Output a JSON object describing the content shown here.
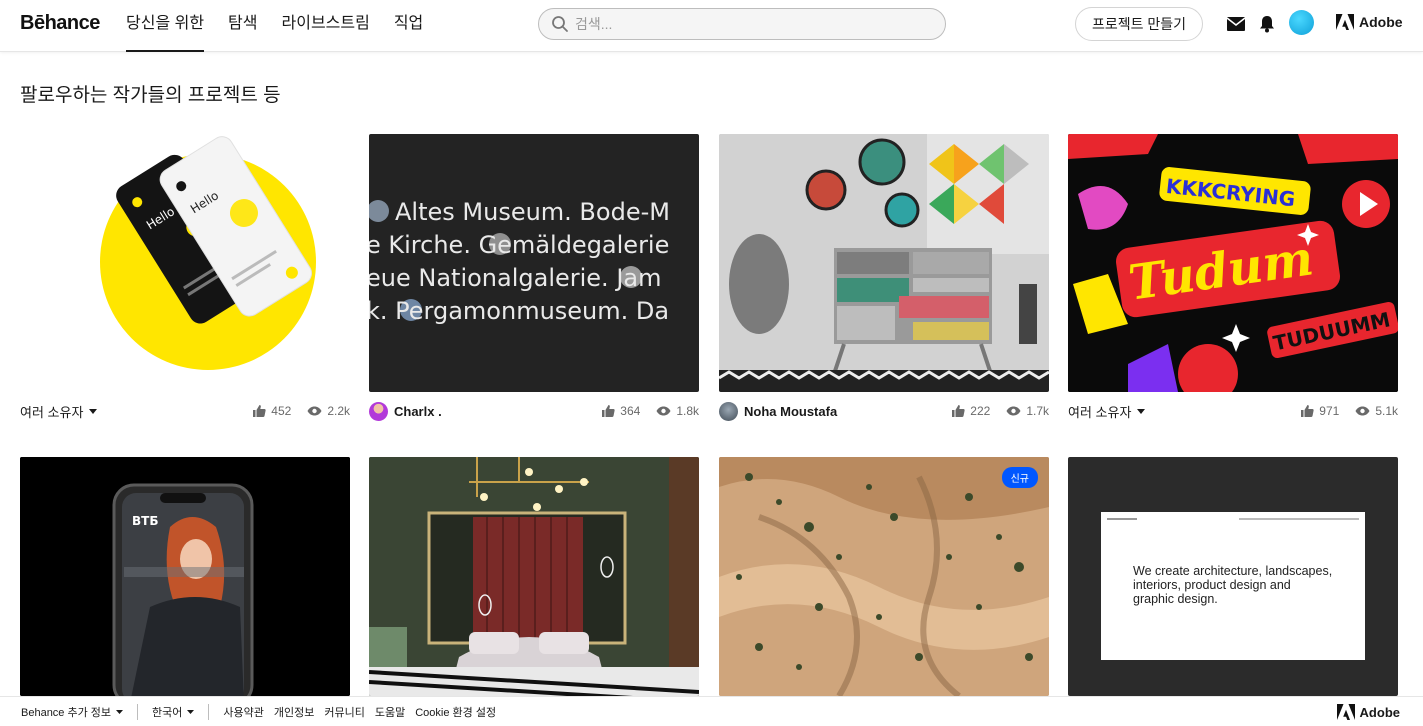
{
  "header": {
    "logo": "Bēhance",
    "nav": [
      {
        "label": "당신을 위한",
        "active": true
      },
      {
        "label": "탐색",
        "active": false
      },
      {
        "label": "라이브스트림",
        "active": false
      },
      {
        "label": "직업",
        "active": false
      }
    ],
    "search_placeholder": "검색...",
    "create_label": "프로젝트 만들기",
    "adobe_label": "Adobe"
  },
  "section_title": "팔로우하는 작가들의 프로젝트 등",
  "projects": [
    {
      "owner": "여러 소유자",
      "multi": true,
      "likes": "452",
      "views": "2.2k",
      "thumb": "hello-app"
    },
    {
      "owner": "Charlx .",
      "multi": false,
      "likes": "364",
      "views": "1.8k",
      "thumb": "museum-typography"
    },
    {
      "owner": "Noha Moustafa",
      "multi": false,
      "likes": "222",
      "views": "1.7k",
      "thumb": "interior-dresser"
    },
    {
      "owner": "여러 소유자",
      "multi": true,
      "likes": "971",
      "views": "5.1k",
      "thumb": "stickers"
    },
    {
      "thumb": "vtb-phone"
    },
    {
      "thumb": "bedroom"
    },
    {
      "thumb": "desert-aerial",
      "badge": "신규"
    },
    {
      "thumb": "architecture-site",
      "site_text": "We create architecture, landscapes, interiors, product design and graphic design."
    }
  ],
  "museum_lines": [
    "Altes Museum. Bode-M",
    "e Kirche. Gemäldegalerie",
    "eue Nationalgalerie. Jam",
    "k. Pergamonmuseum. Da"
  ],
  "thumb_texts": {
    "hello_a": "Hello",
    "hello_b": "Hello",
    "sticker_a": "KKKCRYING",
    "sticker_b": "Tudum",
    "sticker_c": "TUDUUMM",
    "vtb": "ВТБ"
  },
  "footer": {
    "items": [
      "Behance 추가 정보",
      "한국어",
      "사용약관",
      "개인정보",
      "커뮤니티",
      "도움말",
      "Cookie 환경 설정"
    ],
    "adobe_label": "Adobe"
  },
  "colors": {
    "accent": "#0057ff",
    "text": "#191919",
    "muted": "#696969"
  }
}
